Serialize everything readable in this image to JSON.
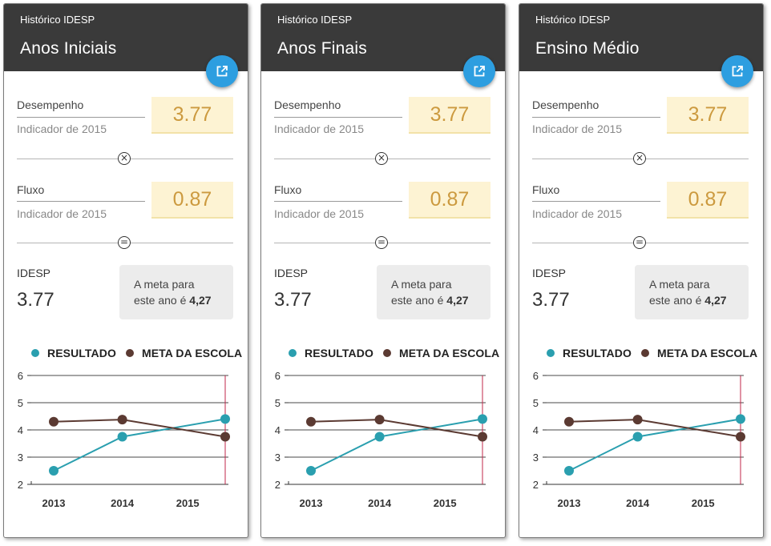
{
  "colors": {
    "header_bg": "#3a3a3a",
    "fab": "#2d9ee0",
    "value_bg": "#fdf3d3",
    "value_text": "#cc9a3f",
    "resultado": "#2a9faf",
    "meta": "#5b3a32",
    "marker_line": "#c0274a"
  },
  "legend": {
    "resultado": "RESULTADO",
    "meta": "META DA ESCOLA"
  },
  "cards": [
    {
      "header_sub": "Histórico IDESP",
      "title": "Anos Iniciais",
      "open_icon": "open-in-new-icon",
      "desempenho": {
        "label": "Desempenho",
        "sub": "Indicador de 2015",
        "value": "3.77"
      },
      "op1_icon": "multiply-icon",
      "fluxo": {
        "label": "Fluxo",
        "sub": "Indicador de 2015",
        "value": "0.87"
      },
      "op2_icon": "equals-icon",
      "idesp": {
        "label": "IDESP",
        "value": "3.77"
      },
      "meta": {
        "line1": "A meta para",
        "line2": "este ano é ",
        "value": "4,27"
      },
      "chart_data": {
        "type": "line",
        "x": [
          "2013",
          "2014",
          "2015"
        ],
        "yticks": [
          2,
          3,
          4,
          5,
          6
        ],
        "ylim": [
          2,
          6
        ],
        "series": [
          {
            "name": "RESULTADO",
            "x": [
              2013,
              2014,
              2015.5
            ],
            "values": [
              2.5,
              3.75,
              4.4
            ]
          },
          {
            "name": "META DA ESCOLA",
            "x": [
              2013,
              2014,
              2015.5
            ],
            "values": [
              4.3,
              4.38,
              3.75
            ]
          }
        ],
        "marker_x": 2015.5,
        "grid": true,
        "legend": "top"
      }
    },
    {
      "header_sub": "Histórico IDESP",
      "title": "Anos Finais",
      "open_icon": "open-in-new-icon",
      "desempenho": {
        "label": "Desempenho",
        "sub": "Indicador de 2015",
        "value": "3.77"
      },
      "op1_icon": "multiply-icon",
      "fluxo": {
        "label": "Fluxo",
        "sub": "Indicador de 2015",
        "value": "0.87"
      },
      "op2_icon": "equals-icon",
      "idesp": {
        "label": "IDESP",
        "value": "3.77"
      },
      "meta": {
        "line1": "A meta para",
        "line2": "este ano é ",
        "value": "4,27"
      },
      "chart_data": {
        "type": "line",
        "x": [
          "2013",
          "2014",
          "2015"
        ],
        "yticks": [
          2,
          3,
          4,
          5,
          6
        ],
        "ylim": [
          2,
          6
        ],
        "series": [
          {
            "name": "RESULTADO",
            "x": [
              2013,
              2014,
              2015.5
            ],
            "values": [
              2.5,
              3.75,
              4.4
            ]
          },
          {
            "name": "META DA ESCOLA",
            "x": [
              2013,
              2014,
              2015.5
            ],
            "values": [
              4.3,
              4.38,
              3.75
            ]
          }
        ],
        "marker_x": 2015.5,
        "grid": true,
        "legend": "top"
      }
    },
    {
      "header_sub": "Histórico IDESP",
      "title": "Ensino Médio",
      "open_icon": "open-in-new-icon",
      "desempenho": {
        "label": "Desempenho",
        "sub": "Indicador de 2015",
        "value": "3.77"
      },
      "op1_icon": "multiply-icon",
      "fluxo": {
        "label": "Fluxo",
        "sub": "Indicador de 2015",
        "value": "0.87"
      },
      "op2_icon": "equals-icon",
      "idesp": {
        "label": "IDESP",
        "value": "3.77"
      },
      "meta": {
        "line1": "A meta para",
        "line2": "este ano é ",
        "value": "4,27"
      },
      "chart_data": {
        "type": "line",
        "x": [
          "2013",
          "2014",
          "2015"
        ],
        "yticks": [
          2,
          3,
          4,
          5,
          6
        ],
        "ylim": [
          2,
          6
        ],
        "series": [
          {
            "name": "RESULTADO",
            "x": [
              2013,
              2014,
              2015.5
            ],
            "values": [
              2.5,
              3.75,
              4.4
            ]
          },
          {
            "name": "META DA ESCOLA",
            "x": [
              2013,
              2014,
              2015.5
            ],
            "values": [
              4.3,
              4.38,
              3.75
            ]
          }
        ],
        "marker_x": 2015.5,
        "grid": true,
        "legend": "top"
      }
    }
  ]
}
